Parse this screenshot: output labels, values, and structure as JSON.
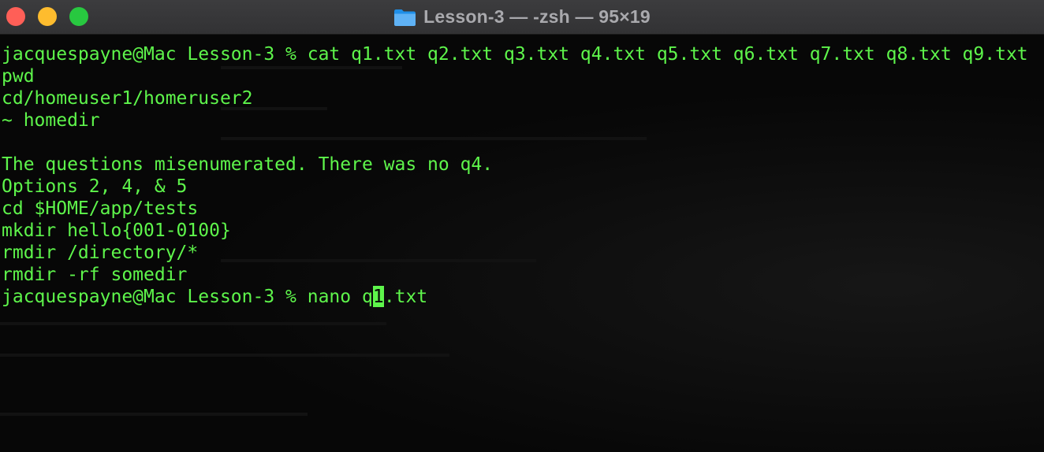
{
  "window": {
    "title": "Lesson-3 — -zsh — 95×19",
    "folder_icon": "folder-icon",
    "colors": {
      "close": "#ff5f57",
      "minimize": "#febc2e",
      "maximize": "#28c840",
      "text": "#5ef54b",
      "background": "#070707"
    }
  },
  "terminal": {
    "lines": [
      "jacquespayne@Mac Lesson-3 % cat q1.txt q2.txt q3.txt q4.txt q5.txt q6.txt q7.txt q8.txt q9.txt",
      "pwd",
      "cd/homeuser1/homeruser2",
      "~ homedir",
      "",
      "The questions misenumerated. There was no q4.",
      "Options 2, 4, & 5",
      "cd $HOME/app/tests",
      "mkdir hello{001-0100}",
      "rmdir /directory/*",
      "rmdir -rf somedir"
    ],
    "prompt_before_cursor": "jacquespayne@Mac Lesson-3 % nano q",
    "prompt_cursor_char": "1",
    "prompt_after_cursor": ".txt"
  }
}
